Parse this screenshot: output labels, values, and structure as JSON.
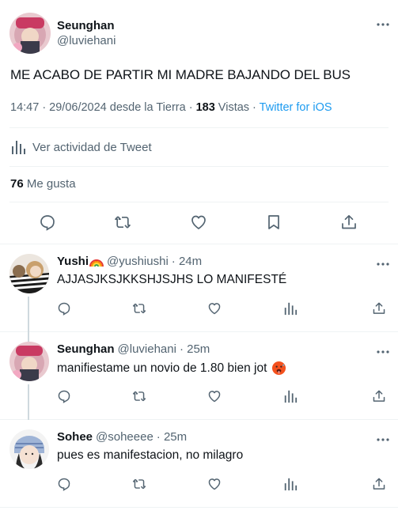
{
  "main_tweet": {
    "author": {
      "name": "Seunghan",
      "handle": "@luviehani"
    },
    "text": "ME ACABO DE PARTIR MI MADRE BAJANDO DEL BUS",
    "meta": {
      "time_date": "14:47 · 29/06/2024 desde la Tierra · ",
      "views_count": "183",
      "views_label": " Vistas · ",
      "client": "Twitter for iOS"
    },
    "activity_label": "Ver actividad de Tweet",
    "likes_count": "76",
    "likes_label": " Me gusta",
    "icons": [
      "reply-icon",
      "retweet-icon",
      "like-icon",
      "bookmark-icon",
      "share-icon",
      "more-icon",
      "analytics-icon"
    ]
  },
  "replies": [
    {
      "name": "Yushi",
      "emoji": "rainbow-emoji",
      "handle": "@yushiushi",
      "time": "· 24m",
      "text": "AJJASJKSJKKSHJSJHS LO MANIFESTÉ"
    },
    {
      "name": "Seunghan",
      "emoji": "",
      "handle": "@luviehani",
      "time": "· 25m",
      "text": "manifiestame un novio de 1.80 bien jot",
      "trailing_emoji": "hot-face-emoji"
    },
    {
      "name": "Sohee",
      "emoji": "",
      "handle": "@soheeee",
      "time": "· 25m",
      "text": "pues es manifestacion, no milagro"
    }
  ],
  "colors": {
    "text": "#0f1419",
    "secondary": "#536471",
    "link": "#1d9bf0",
    "divider": "#eff3f4",
    "thread": "#cfd9de"
  }
}
